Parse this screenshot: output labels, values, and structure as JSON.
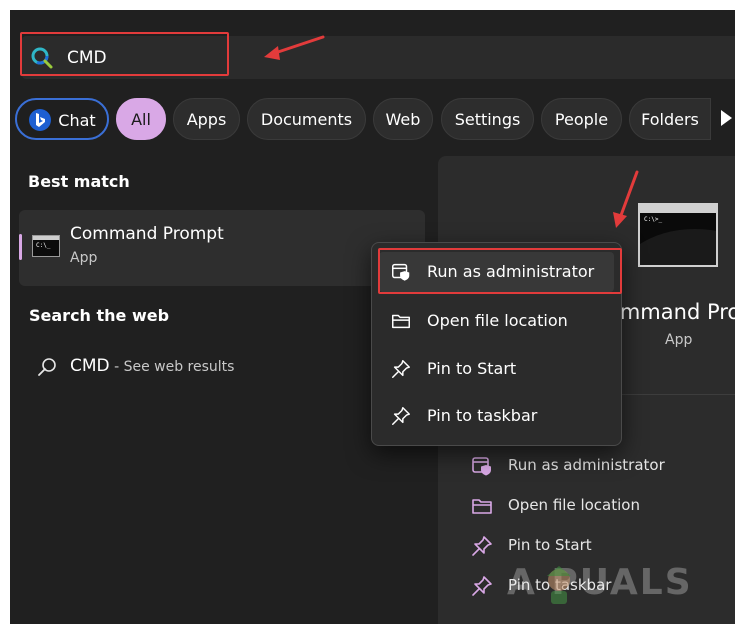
{
  "search": {
    "query": "CMD"
  },
  "filters": {
    "chat": "Chat",
    "all": "All",
    "apps": "Apps",
    "documents": "Documents",
    "web": "Web",
    "settings": "Settings",
    "people": "People",
    "folders": "Folders"
  },
  "best_match": {
    "heading": "Best match",
    "app_name": "Command Prompt",
    "app_type": "App"
  },
  "search_web": {
    "heading": "Search the web",
    "query": "CMD",
    "suffix": " - See web results"
  },
  "preview": {
    "title": "ommand Prom",
    "subtitle": "App",
    "actions": [
      {
        "label": "Run as administrator",
        "icon": "shield-admin-icon"
      },
      {
        "label": "Open file location",
        "icon": "folder-icon"
      },
      {
        "label": "Pin to Start",
        "icon": "pin-icon"
      },
      {
        "label": "Pin to taskbar",
        "icon": "pin-icon"
      }
    ]
  },
  "context_menu": {
    "items": [
      {
        "label": "Run as administrator",
        "icon": "shield-admin-icon"
      },
      {
        "label": "Open file location",
        "icon": "folder-icon"
      },
      {
        "label": "Pin to Start",
        "icon": "pin-icon"
      },
      {
        "label": "Pin to taskbar",
        "icon": "pin-icon"
      }
    ]
  },
  "watermark": "A  PUALS",
  "colors": {
    "highlight": "#e23b3b",
    "accent": "#d9a8e6",
    "chat_border": "#3a6fd6"
  }
}
